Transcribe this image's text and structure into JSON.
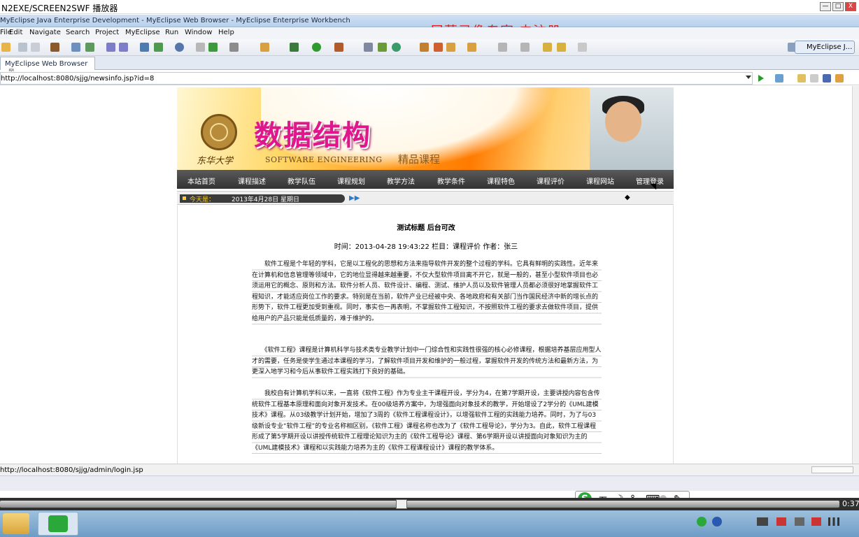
{
  "recorder": {
    "title": "N2EXE/SCREEN2SWF 播放器",
    "minimize": "—",
    "maximize": "□",
    "close": "X",
    "time": "0:37"
  },
  "eclipse": {
    "title": "MyEclipse Java Enterprise Development - MyEclipse Web Browser - MyEclipse Enterprise Workbench",
    "watermark": "屏幕录像专家  未注册",
    "menu": [
      "File",
      "Edit",
      "Navigate",
      "Search",
      "Project",
      "MyEclipse",
      "Run",
      "Window",
      "Help"
    ],
    "perspective": "MyEclipse J...",
    "tab_label": "MyEclipse Web Browser",
    "tab_close": "⊠",
    "url": "http://localhost:8080/sjjg/newsinfo.jsp?id=8",
    "status_url": "http://localhost:8080/sjjg/admin/login.jsp"
  },
  "site": {
    "university": "东华大学",
    "title": "数据结构",
    "subtitle": "SOFTWARE ENGINEERING",
    "tagline": "精品课程",
    "nav": [
      "本站首页",
      "课程描述",
      "教学队伍",
      "课程规划",
      "教学方法",
      "教学条件",
      "课程特色",
      "课程评价",
      "课程网站",
      "管理登录"
    ],
    "date_label": "今天是：",
    "date_value": "2013年4月28日  星期日"
  },
  "article": {
    "title": "测试标题  后台可改",
    "meta": "时间：2013-04-28 19:43:22   栏目：课程评价    作者：张三",
    "paragraphs": [
      "　　软件工程是个年轻的学科，它是以工程化的思想和方法来指导软件开发的整个过程的学科。它具有鲜明的实践性。近年来在计算机和信息管理等领域中，它的地位显得越来越重要，不仅大型软件项目离不开它，就是一般的，甚至小型软件项目也必须运用它的概念、原则和方法。软件分析人员、软件设计、编程、测试、维护人员以及软件管理人员都必须很好地掌握软件工程知识，才能适应岗位工作的要求。特别是在当前，软件产业已经被中央、各地政府和有关部门当作国民经济中新的增长点的形势下，软件工程更加受到重视。同时，事实也一再表明，不掌握软件工程知识，不按照软件工程的要求去做软件项目，提供给用户的产品只能是低质量的，难于维护的。",
      "　　《软件工程》课程是计算机科学与技术类专业教学计划中一门综合性和实践性很强的核心必修课程，根据培养基层应用型人才的需要，任务是使学生通过本课程的学习，了解软件项目开发和维护的一般过程，掌握软件开发的传统方法和最新方法，为更深入地学习和今后从事软件工程实践打下良好的基础。",
      "　　我校自有计算机学科以来，一直将《软件工程》作为专业主干课程开设，学分为4，在第7学期开设，主要讲授内容包含传统软件工程基本原理和面向对象开发技术。在00级培养方案中，为增强面向对象技术的教学，开始增设了2学分的《UML建模技术》课程。从03级教学计划开始，增加了3周的《软件工程课程设计》，以增强软件工程的实践能力培养。同时，为了与03级新设专业“软件工程”的专业名称相区别，《软件工程》课程名称也改为了《软件工程导论》，学分为3。自此，软件工程课程形成了第5学期开设以讲授传统软件工程理论知识为主的《软件工程导论》课程、第6学期开设以讲授面向对象知识为主的《UML建模技术》课程和以实践能力培养为主的《软件工程课程设计》课程的教学体系。"
    ]
  },
  "ime": {
    "logo": "S",
    "mode": "五",
    "moon": "☽",
    "punct": "°,",
    "keyboard": "⌨",
    "tools": "✎"
  },
  "colors": {
    "nav_bg": "#3f3f3f",
    "title_pink": "#e0178c",
    "watermark_red": "#e02020",
    "banner_orange": "#ff7a00"
  }
}
